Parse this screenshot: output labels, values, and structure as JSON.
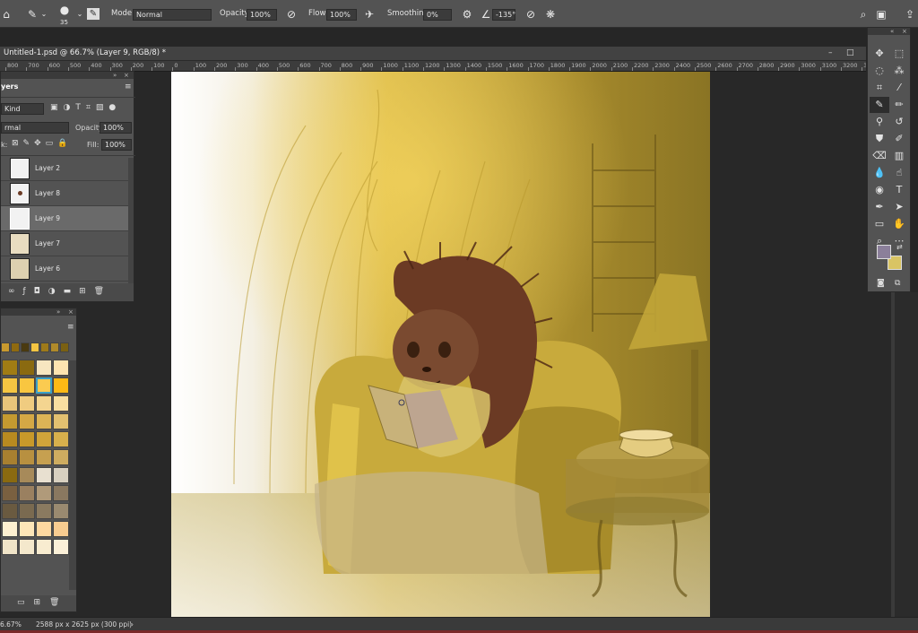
{
  "colors": {
    "canvas_bg": "#262626",
    "panel": "#535353",
    "fg_swatch": "#8b7f9a",
    "bg_swatch": "#d9c464",
    "accent": "#3aa0c8"
  },
  "options_bar": {
    "mode_label": "Mode:",
    "mode_value": "Normal",
    "opacity_label": "Opacity:",
    "opacity_value": "100%",
    "flow_label": "Flow:",
    "flow_value": "100%",
    "smoothing_label": "Smoothing:",
    "smoothing_value": "0%",
    "angle_value": "-135°",
    "brush_size": "35"
  },
  "document": {
    "tab_title": "Untitled-1.psd @ 66.7% (Layer 9, RGB/8) *"
  },
  "ruler": {
    "labels": [
      "800",
      "700",
      "600",
      "500",
      "400",
      "300",
      "200",
      "100",
      "0",
      "100",
      "200",
      "300",
      "400",
      "500",
      "600",
      "700",
      "800",
      "900",
      "1000",
      "1100",
      "1200",
      "1300",
      "1400",
      "1500",
      "1600",
      "1700",
      "1800",
      "1900",
      "2000",
      "2100",
      "2200",
      "2300",
      "2400",
      "2500",
      "2600",
      "2700",
      "2800",
      "2900",
      "3000",
      "3100",
      "3200",
      "33"
    ]
  },
  "layers_panel": {
    "title": "yers",
    "kind_label": "Kind",
    "blend_value": "rmal",
    "opacity_label": "Opacity:",
    "opacity_value": "100%",
    "lock_label": "k:",
    "fill_label": "Fill:",
    "fill_value": "100%",
    "layers": [
      {
        "name": "Layer 2"
      },
      {
        "name": "Layer 8"
      },
      {
        "name": "Layer 9"
      },
      {
        "name": "Layer 7"
      },
      {
        "name": "Layer 6"
      }
    ]
  },
  "status": {
    "zoom": "6.67%",
    "doc_size": "2588 px x 2625 px (300 ppi)"
  },
  "swatches": {
    "recent": [
      "#c99a2e",
      "#8f6a10",
      "#4a3a10",
      "#f5c542",
      "#9e7a1a",
      "#b08a2a",
      "#7a6012"
    ],
    "grid": [
      [
        "#a07c14",
        "#8a6a10",
        "#f7e6c0",
        "#fde3b0"
      ],
      [
        "#f5c542",
        "#f9c640",
        "#fbcb50",
        "#fdb915"
      ],
      [
        "#e8c47a",
        "#f0cc80",
        "#f4d590",
        "#f8dea0"
      ],
      [
        "#c49a30",
        "#d4a845",
        "#dcb456",
        "#e2c070"
      ],
      [
        "#b88a20",
        "#c8992a",
        "#d0a43a",
        "#d8b04c"
      ],
      [
        "#a88030",
        "#b89040",
        "#c6a050",
        "#ceac60"
      ],
      [
        "#8a6a10",
        "#a78a5a",
        "#e8e0d0",
        "#d8d0c0"
      ],
      [
        "#7a6040",
        "#9a8060",
        "#b09a7a",
        "#8a7860"
      ],
      [
        "#6a5a40",
        "#7a6a50",
        "#8a7a60",
        "#9a8a70"
      ],
      [
        "#fdf0d0",
        "#fde6b8",
        "#fdd8a0",
        "#f8cc90"
      ],
      [
        "#f0e4c8",
        "#f4e8cc",
        "#f8ecd0",
        "#fbf0d8"
      ]
    ]
  },
  "tools": [
    "move-icon",
    "marquee-icon",
    "lasso-icon",
    "magic-wand-icon",
    "crop-icon",
    "eyedropper-icon",
    "brush-icon",
    "pencil-icon",
    "clone-icon",
    "history-brush-icon",
    "stamp-icon",
    "mixer-brush-icon",
    "eraser-icon",
    "gradient-icon",
    "blur-icon",
    "smudge-icon",
    "dodge-icon",
    "type-icon",
    "pen-icon",
    "path-select-icon",
    "rectangle-icon",
    "hand-icon",
    "zoom-icon",
    "more-icon"
  ]
}
